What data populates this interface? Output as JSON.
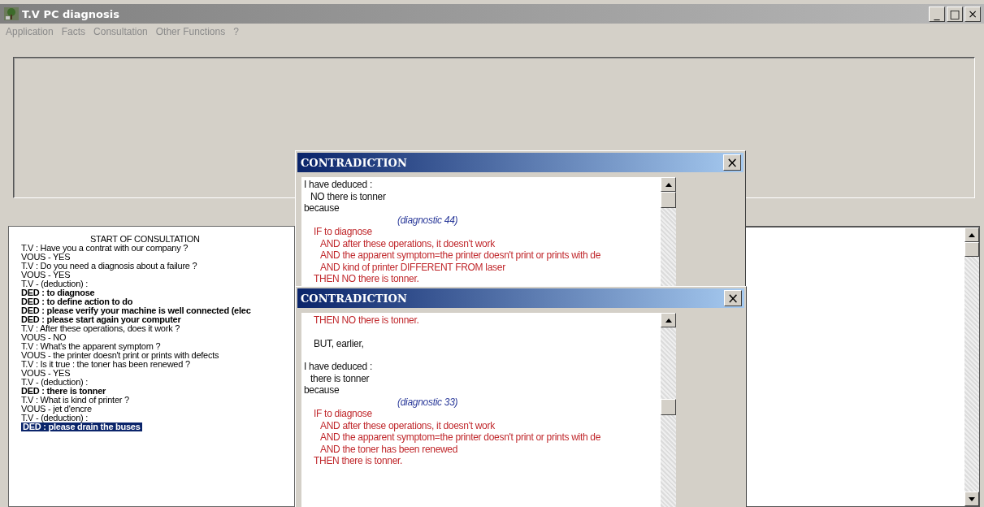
{
  "window": {
    "title": "T.V PC diagnosis",
    "controls": [
      "_",
      "□",
      "×"
    ]
  },
  "menu": [
    "Application",
    "Facts",
    "Consultation",
    "Other Functions",
    "?"
  ],
  "log": [
    {
      "text": "START OF CONSULTATION",
      "kind": "heading",
      "selected": false
    },
    {
      "text": "T.V : Have you a contrat with our company ?",
      "kind": "normal",
      "selected": false
    },
    {
      "text": "VOUS - YES",
      "kind": "normal",
      "selected": false
    },
    {
      "text": "T.V : Do you need a diagnosis about a failure ?",
      "kind": "normal",
      "selected": false
    },
    {
      "text": "VOUS - YES",
      "kind": "normal",
      "selected": false
    },
    {
      "text": "T.V - (deduction) :",
      "kind": "normal",
      "selected": false
    },
    {
      "text": "DED : to diagnose",
      "kind": "bold",
      "selected": false
    },
    {
      "text": "DED : to define action to do",
      "kind": "bold",
      "selected": false
    },
    {
      "text": "DED : please verify your machine is well connected (elec",
      "kind": "bold",
      "selected": false
    },
    {
      "text": "DED : please start again your computer",
      "kind": "bold",
      "selected": false
    },
    {
      "text": "T.V : After these operations, does it work ?",
      "kind": "normal",
      "selected": false
    },
    {
      "text": "VOUS - NO",
      "kind": "normal",
      "selected": false
    },
    {
      "text": "T.V : What's the apparent symptom ?",
      "kind": "normal",
      "selected": false
    },
    {
      "text": "VOUS - the printer doesn't print or prints with defects",
      "kind": "normal",
      "selected": false
    },
    {
      "text": "T.V :  Is it true : the toner has been renewed ?",
      "kind": "normal",
      "selected": false
    },
    {
      "text": "VOUS - YES",
      "kind": "normal",
      "selected": false
    },
    {
      "text": "T.V - (deduction) :",
      "kind": "normal",
      "selected": false
    },
    {
      "text": "DED : there is tonner",
      "kind": "bold",
      "selected": false
    },
    {
      "text": "T.V :  What is kind of printer ?",
      "kind": "normal",
      "selected": false
    },
    {
      "text": "VOUS - jet d'encre",
      "kind": "normal",
      "selected": false
    },
    {
      "text": "T.V - (deduction) :",
      "kind": "normal",
      "selected": false
    },
    {
      "text": "DED : please drain the buses",
      "kind": "bold",
      "selected": true
    }
  ],
  "dialogs": [
    {
      "title": "CONTRADICTION",
      "close": "×",
      "lines": [
        {
          "text": "I have deduced :",
          "kind": "text"
        },
        {
          "text": "NO there is tonner",
          "kind": "fact"
        },
        {
          "text": "because",
          "kind": "text"
        },
        {
          "text": "(diagnostic 44)",
          "kind": "ref"
        },
        {
          "text": "IF to diagnose",
          "kind": "if"
        },
        {
          "text": "AND after these operations, it doesn't work",
          "kind": "and"
        },
        {
          "text": "AND the apparent symptom=the printer doesn't print or prints with de",
          "kind": "and"
        },
        {
          "text": "AND kind of printer DIFFERENT FROM laser",
          "kind": "and"
        },
        {
          "text": "THEN NO there is tonner.",
          "kind": "if"
        }
      ]
    },
    {
      "title": "CONTRADICTION",
      "close": "×",
      "lines": [
        {
          "text": "THEN NO there is tonner.",
          "kind": "if"
        },
        {
          "text": "BUT, earlier,",
          "kind": "note"
        },
        {
          "text": "I have deduced :",
          "kind": "text"
        },
        {
          "text": "there is tonner",
          "kind": "fact"
        },
        {
          "text": "because",
          "kind": "text"
        },
        {
          "text": "(diagnostic 33)",
          "kind": "ref"
        },
        {
          "text": "IF to diagnose",
          "kind": "if"
        },
        {
          "text": "AND after these operations, it doesn't work",
          "kind": "and"
        },
        {
          "text": "AND the apparent symptom=the printer doesn't print or prints with de",
          "kind": "and"
        },
        {
          "text": "AND the toner has been renewed",
          "kind": "and"
        },
        {
          "text": "THEN there is tonner.",
          "kind": "if"
        }
      ]
    }
  ]
}
